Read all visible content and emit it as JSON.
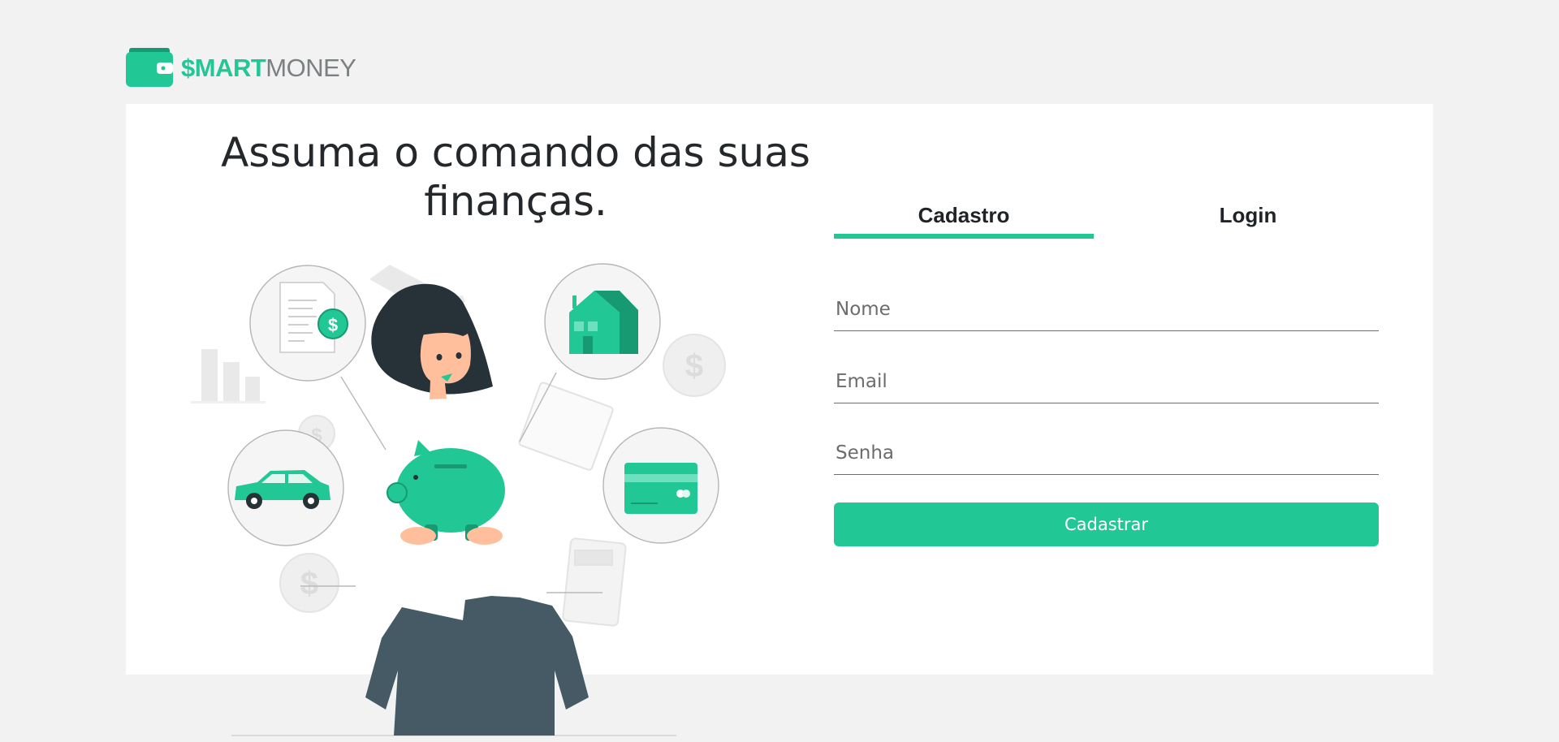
{
  "brand": {
    "smart": "$MART",
    "money": "MONEY",
    "accent": "#21c795",
    "logo_icon": "wallet-icon"
  },
  "hero": {
    "headline": "Assuma o comando das suas finanças.",
    "illustration": "woman-holding-piggy-bank-illustration"
  },
  "tabs": [
    {
      "label": "Cadastro",
      "active": true
    },
    {
      "label": "Login",
      "active": false
    }
  ],
  "form": {
    "name_placeholder": "Nome",
    "email_placeholder": "Email",
    "password_placeholder": "Senha",
    "submit_label": "Cadastrar"
  },
  "colors": {
    "page_background": "#f2f2f2",
    "card_background": "#ffffff",
    "button_text": "#ffffff"
  }
}
